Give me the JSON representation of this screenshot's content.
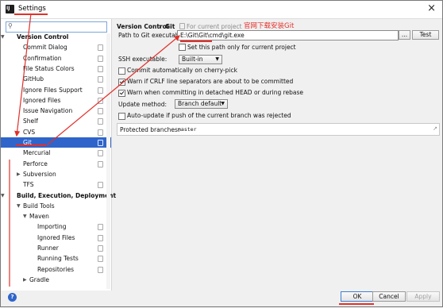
{
  "window": {
    "title": "Settings",
    "close_glyph": "×"
  },
  "search": {
    "value": "",
    "icon": "search-icon"
  },
  "sidebar": {
    "items": [
      {
        "label": "Version Control",
        "level": 0,
        "bold": true,
        "expanded": true
      },
      {
        "label": "Commit Dialog",
        "level": 1
      },
      {
        "label": "Confirmation",
        "level": 1
      },
      {
        "label": "File Status Colors",
        "level": 1
      },
      {
        "label": "GitHub",
        "level": 1
      },
      {
        "label": "Ignore Files Support",
        "level": 1
      },
      {
        "label": "Ignored Files",
        "level": 1
      },
      {
        "label": "Issue Navigation",
        "level": 1
      },
      {
        "label": "Shelf",
        "level": 1
      },
      {
        "label": "CVS",
        "level": 1
      },
      {
        "label": "Git",
        "level": 1,
        "selected": true
      },
      {
        "label": "Mercurial",
        "level": 1
      },
      {
        "label": "Perforce",
        "level": 1
      },
      {
        "label": "Subversion",
        "level": 1,
        "collapsed": true
      },
      {
        "label": "TFS",
        "level": 1
      },
      {
        "label": "Build, Execution, Deployment",
        "level": 0,
        "bold": true,
        "expanded": true
      },
      {
        "label": "Build Tools",
        "level": 1,
        "expanded": true
      },
      {
        "label": "Maven",
        "level": 2,
        "expanded": true
      },
      {
        "label": "Importing",
        "level": 3
      },
      {
        "label": "Ignored Files",
        "level": 3
      },
      {
        "label": "Runner",
        "level": 3
      },
      {
        "label": "Running Tests",
        "level": 3
      },
      {
        "label": "Repositories",
        "level": 3
      },
      {
        "label": "Gradle",
        "level": 2,
        "collapsed": true
      }
    ]
  },
  "content": {
    "breadcrumb": {
      "root": "Version Control",
      "sep": "›",
      "page": "Git",
      "note": "For current project"
    },
    "path": {
      "label": "Path to Git executable:",
      "value": "E:\\Git\\Git\\cmd\\git.exe",
      "browse": "...",
      "test": "Test"
    },
    "set_path_only": "Set this path only for current project",
    "ssh": {
      "label": "SSH executable:",
      "value": "Built-in"
    },
    "checkboxes": [
      {
        "label": "Commit automatically on cherry-pick",
        "checked": false
      },
      {
        "label": "Warn if CRLF line separators are about to be committed",
        "checked": true
      },
      {
        "label": "Warn when committing in detached HEAD or during rebase",
        "checked": true
      }
    ],
    "update": {
      "label": "Update method:",
      "value": "Branch default"
    },
    "auto_update": {
      "label": "Auto-update if push of the current branch was rejected",
      "checked": false
    },
    "protected": {
      "label": "Protected branches:",
      "value": "master"
    }
  },
  "annotation": {
    "text": "官网下载安装Git",
    "color": "#e2302a"
  },
  "footer": {
    "help": "?",
    "ok": "OK",
    "cancel": "Cancel",
    "apply": "Apply"
  }
}
